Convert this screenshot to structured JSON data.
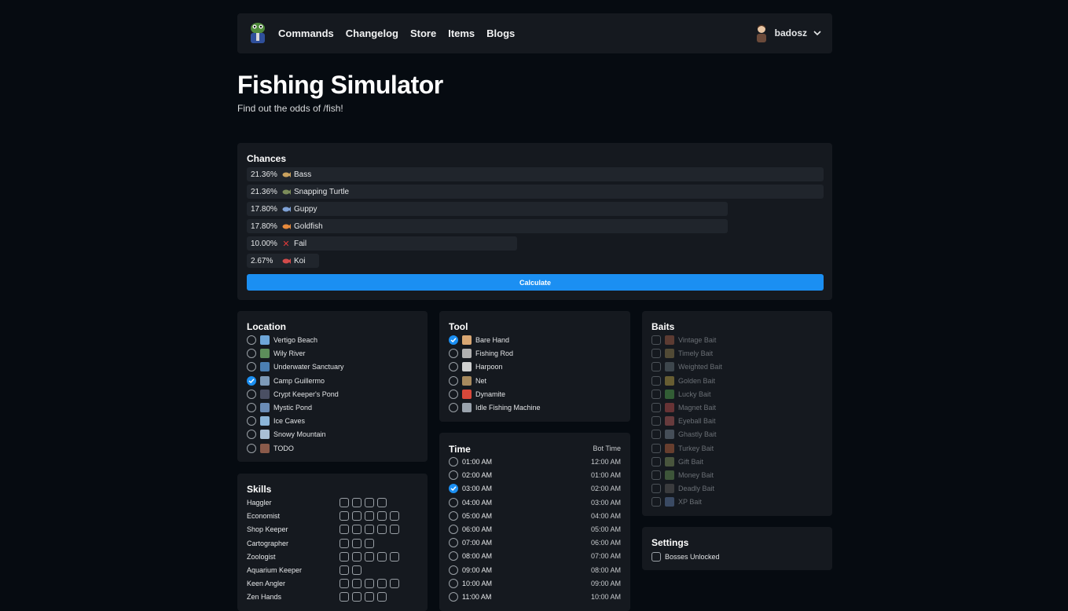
{
  "nav": {
    "links": [
      "Commands",
      "Changelog",
      "Store",
      "Items",
      "Blogs"
    ],
    "user": "badosz"
  },
  "page": {
    "title": "Fishing Simulator",
    "subtitle": "Find out the odds of /fish!"
  },
  "chances": {
    "title": "Chances",
    "rows": [
      {
        "pct": "21.36%",
        "name": "Bass",
        "fill": 0.2136,
        "icon_color": "#c9a15e"
      },
      {
        "pct": "21.36%",
        "name": "Snapping Turtle",
        "fill": 0.2136,
        "icon_color": "#7c8c5a"
      },
      {
        "pct": "17.80%",
        "name": "Guppy",
        "fill": 0.178,
        "icon_color": "#7fa2d6"
      },
      {
        "pct": "17.80%",
        "name": "Goldfish",
        "fill": 0.178,
        "icon_color": "#e78a3c"
      },
      {
        "pct": "10.00%",
        "name": "Fail",
        "fill": 0.1,
        "icon_color": "#e03a3a"
      },
      {
        "pct": "2.67%",
        "name": "Koi",
        "fill": 0.0267,
        "icon_color": "#d24b4b"
      }
    ],
    "button": "Calculate"
  },
  "location": {
    "title": "Location",
    "options": [
      {
        "label": "Vertigo Beach",
        "selected": false,
        "icon_color": "#6ea6d8"
      },
      {
        "label": "Wily River",
        "selected": false,
        "icon_color": "#5c8d5a"
      },
      {
        "label": "Underwater Sanctuary",
        "selected": false,
        "icon_color": "#4b7fb3"
      },
      {
        "label": "Camp Guillermo",
        "selected": true,
        "icon_color": "#7d9ab8"
      },
      {
        "label": "Crypt Keeper's Pond",
        "selected": false,
        "icon_color": "#4a4f63"
      },
      {
        "label": "Mystic Pond",
        "selected": false,
        "icon_color": "#6a8bb5"
      },
      {
        "label": "Ice Caves",
        "selected": false,
        "icon_color": "#8cb5d9"
      },
      {
        "label": "Snowy Mountain",
        "selected": false,
        "icon_color": "#a9bfd6"
      },
      {
        "label": "TODO",
        "selected": false,
        "icon_color": "#8a5a4a"
      }
    ]
  },
  "tool": {
    "title": "Tool",
    "options": [
      {
        "label": "Bare Hand",
        "selected": true,
        "icon_color": "#d9a773"
      },
      {
        "label": "Fishing Rod",
        "selected": false,
        "icon_color": "#b0b0b0"
      },
      {
        "label": "Harpoon",
        "selected": false,
        "icon_color": "#d0d0d0"
      },
      {
        "label": "Net",
        "selected": false,
        "icon_color": "#a88a5e"
      },
      {
        "label": "Dynamite",
        "selected": false,
        "icon_color": "#d9483a"
      },
      {
        "label": "Idle Fishing Machine",
        "selected": false,
        "icon_color": "#9aa3ad"
      }
    ]
  },
  "baits": {
    "title": "Baits",
    "options": [
      {
        "label": "Vintage Bait",
        "icon_color": "#7a4a3a"
      },
      {
        "label": "Timely Bait",
        "icon_color": "#6b5f3f"
      },
      {
        "label": "Weighted Bait",
        "icon_color": "#4f5a60"
      },
      {
        "label": "Golden Bait",
        "icon_color": "#8a7a3a"
      },
      {
        "label": "Lucky Bait",
        "icon_color": "#3f7a3f"
      },
      {
        "label": "Magnet Bait",
        "icon_color": "#8a3f3f"
      },
      {
        "label": "Eyeball Bait",
        "icon_color": "#8a4a4a"
      },
      {
        "label": "Ghastly Bait",
        "icon_color": "#5a6570"
      },
      {
        "label": "Turkey Bait",
        "icon_color": "#8a4f35"
      },
      {
        "label": "Gift Bait",
        "icon_color": "#5f6f4a"
      },
      {
        "label": "Money Bait",
        "icon_color": "#4f6f45"
      },
      {
        "label": "Deadly Bait",
        "icon_color": "#4a4a4a"
      },
      {
        "label": "XP Bait",
        "icon_color": "#4a5f80"
      }
    ]
  },
  "settings": {
    "title": "Settings",
    "options": [
      {
        "label": "Bosses Unlocked",
        "checked": false
      }
    ]
  },
  "skills": {
    "title": "Skills",
    "rows": [
      {
        "name": "Haggler",
        "levels": 4
      },
      {
        "name": "Economist",
        "levels": 5
      },
      {
        "name": "Shop Keeper",
        "levels": 5
      },
      {
        "name": "Cartographer",
        "levels": 3
      },
      {
        "name": "Zoologist",
        "levels": 5
      },
      {
        "name": "Aquarium Keeper",
        "levels": 2
      },
      {
        "name": "Keen Angler",
        "levels": 5
      },
      {
        "name": "Zen Hands",
        "levels": 4
      }
    ]
  },
  "time": {
    "title": "Time",
    "header_right": "Bot Time",
    "rows": [
      {
        "local": "01:00 AM",
        "bot": "12:00 AM",
        "selected": false
      },
      {
        "local": "02:00 AM",
        "bot": "01:00 AM",
        "selected": false
      },
      {
        "local": "03:00 AM",
        "bot": "02:00 AM",
        "selected": true
      },
      {
        "local": "04:00 AM",
        "bot": "03:00 AM",
        "selected": false
      },
      {
        "local": "05:00 AM",
        "bot": "04:00 AM",
        "selected": false
      },
      {
        "local": "06:00 AM",
        "bot": "05:00 AM",
        "selected": false
      },
      {
        "local": "07:00 AM",
        "bot": "06:00 AM",
        "selected": false
      },
      {
        "local": "08:00 AM",
        "bot": "07:00 AM",
        "selected": false
      },
      {
        "local": "09:00 AM",
        "bot": "08:00 AM",
        "selected": false
      },
      {
        "local": "10:00 AM",
        "bot": "09:00 AM",
        "selected": false
      },
      {
        "local": "11:00 AM",
        "bot": "10:00 AM",
        "selected": false
      }
    ]
  },
  "colors": {
    "accent": "#1b8ff2",
    "panel": "#15191f",
    "background": "#060b11"
  }
}
